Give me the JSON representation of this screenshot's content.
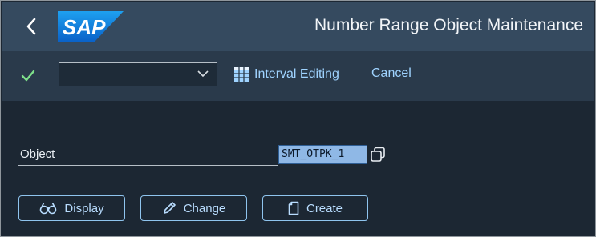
{
  "shell": {
    "title": "Number Range Object Maintenance",
    "logo_text": "SAP"
  },
  "toolbar": {
    "dropdown_value": "",
    "interval_label": "Interval Editing",
    "cancel_label": "Cancel"
  },
  "form": {
    "object_label": "Object",
    "object_value": "SMT_OTPK_1"
  },
  "actions": {
    "display_label": "Display",
    "change_label": "Change",
    "create_label": "Create"
  },
  "colors": {
    "shellbar": "#354a5f",
    "toolbar": "#2a3a4b",
    "background": "#1c2733",
    "accent": "#9fd3ff",
    "ok_green": "#7ee08a"
  }
}
